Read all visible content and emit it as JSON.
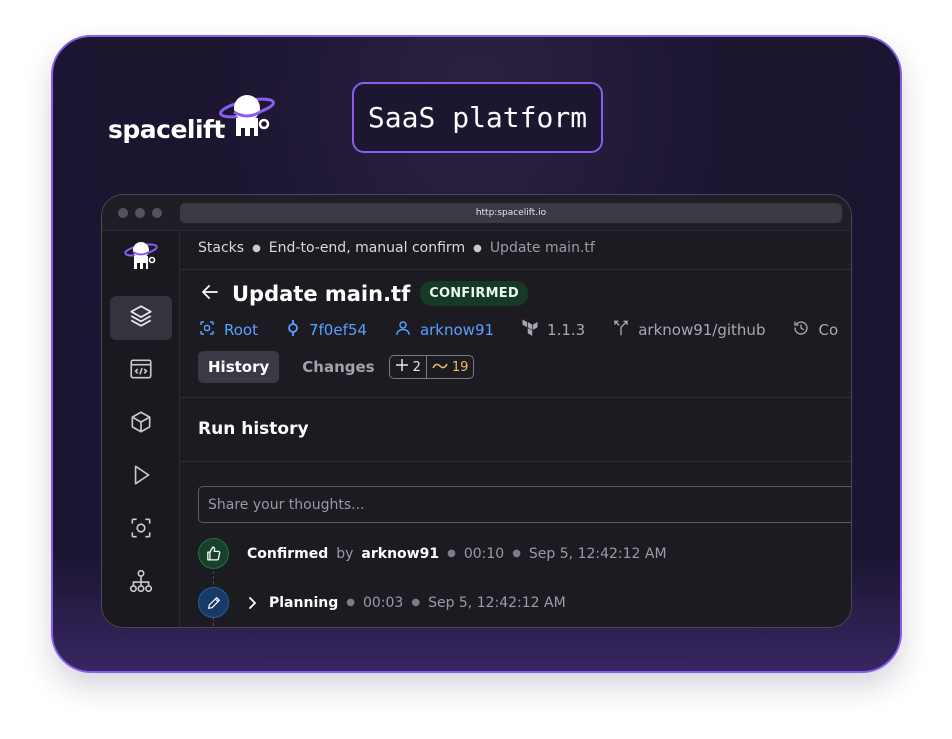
{
  "brand": {
    "name": "spacelift"
  },
  "badge": {
    "label": "SaaS platform"
  },
  "browser": {
    "url": "http:spacelift.io"
  },
  "breadcrumb": {
    "items": [
      "Stacks",
      "End-to-end, manual confirm",
      "Update main.tf"
    ]
  },
  "run": {
    "title": "Update main.tf",
    "status": "CONFIRMED",
    "status_color": "#173a27"
  },
  "meta": {
    "path": "Root",
    "commit": "7f0ef54",
    "author": "arknow91",
    "terraform_version": "1.1.3",
    "vcs_integration": "arknow91/github",
    "truncated": "Co"
  },
  "tabs": {
    "history": "History",
    "changes": "Changes",
    "added": "2",
    "modified": "19"
  },
  "section": {
    "title": "Run history"
  },
  "comment": {
    "placeholder": "Share your thoughts..."
  },
  "events": [
    {
      "status": "Confirmed",
      "by_label": "by",
      "user": "arknow91",
      "duration": "00:10",
      "timestamp": "Sep 5, 12:42:12 AM"
    },
    {
      "status": "Planning",
      "duration": "00:03",
      "timestamp": "Sep 5, 12:42:12 AM"
    }
  ],
  "colors": {
    "accent": "#8a5cf0",
    "link": "#5aa0ff",
    "modified": "#f0c060",
    "background": "#1c1b22"
  }
}
